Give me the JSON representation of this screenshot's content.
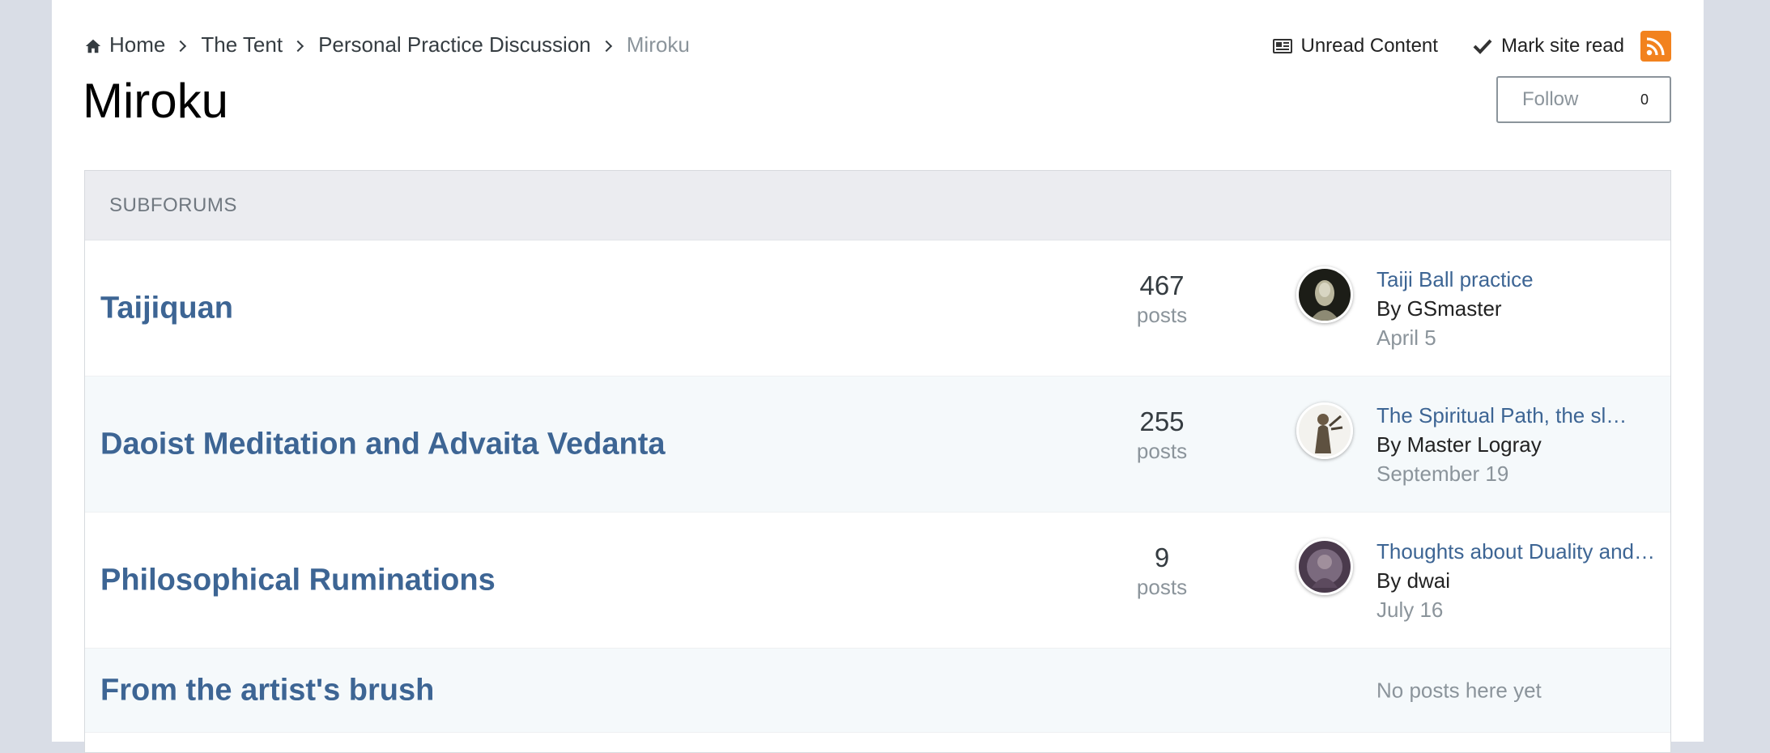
{
  "breadcrumb": {
    "items": [
      {
        "label": "Home",
        "icon": "home-icon"
      },
      {
        "label": "The Tent"
      },
      {
        "label": "Personal Practice Discussion"
      },
      {
        "label": "Miroku",
        "current": true
      }
    ]
  },
  "actions": {
    "unread_label": "Unread Content",
    "unread_icon": "newspaper-icon",
    "mark_read_label": "Mark site read",
    "mark_read_icon": "check-icon",
    "rss_icon": "rss-icon"
  },
  "page": {
    "title": "Miroku"
  },
  "follow": {
    "label": "Follow",
    "count": "0"
  },
  "subforums": {
    "header": "SUBFORUMS",
    "rows": [
      {
        "title": "Taijiquan",
        "post_count": "467",
        "post_label": "posts",
        "last_title": "Taiji Ball practice",
        "last_by": "By GSmaster",
        "last_date": "April 5"
      },
      {
        "title": "Daoist Meditation and Advaita Vedanta",
        "post_count": "255",
        "post_label": "posts",
        "last_title": "The Spiritual Path, the sl…",
        "last_by": "By Master Logray",
        "last_date": "September 19"
      },
      {
        "title": "Philosophical Ruminations",
        "post_count": "9",
        "post_label": "posts",
        "last_title": "Thoughts about Duality and…",
        "last_by": "By dwai",
        "last_date": "July 16"
      },
      {
        "title": "From the artist's brush",
        "no_posts": "No posts here yet"
      }
    ]
  },
  "colors": {
    "link": "#3d6594",
    "muted": "#8b949b",
    "rss": "#f2821e",
    "header_bg": "#ebecf0",
    "alt_row": "#f5f9fb",
    "outer_bg": "#d9dde6"
  }
}
